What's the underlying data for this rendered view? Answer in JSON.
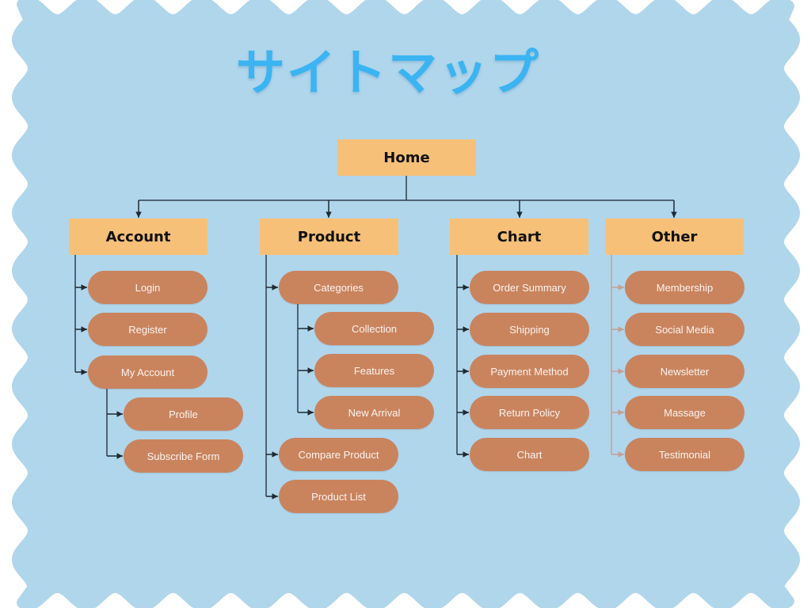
{
  "title": "サイトマップ",
  "colors": {
    "background": "#b0d6ec",
    "title": "#3ab4f2",
    "header_box": "#f7c078",
    "pill": "#c9845e",
    "line": "#2f3e4a",
    "line_other": "#c4a090"
  },
  "root": {
    "label": "Home"
  },
  "sections": [
    {
      "label": "Account",
      "items": [
        {
          "label": "Login"
        },
        {
          "label": "Register"
        },
        {
          "label": "My Account",
          "children": [
            {
              "label": "Profile"
            },
            {
              "label": "Subscribe Form"
            }
          ]
        }
      ]
    },
    {
      "label": "Product",
      "items": [
        {
          "label": "Categories",
          "children": [
            {
              "label": "Collection"
            },
            {
              "label": "Features"
            },
            {
              "label": "New Arrival"
            }
          ]
        },
        {
          "label": "Compare Product"
        },
        {
          "label": "Product List"
        }
      ]
    },
    {
      "label": "Chart",
      "items": [
        {
          "label": "Order Summary"
        },
        {
          "label": "Shipping"
        },
        {
          "label": "Payment Method"
        },
        {
          "label": "Return Policy"
        },
        {
          "label": "Chart"
        }
      ]
    },
    {
      "label": "Other",
      "items": [
        {
          "label": "Membership"
        },
        {
          "label": "Social Media"
        },
        {
          "label": "Newsletter"
        },
        {
          "label": "Massage"
        },
        {
          "label": "Testimonial"
        }
      ]
    }
  ]
}
